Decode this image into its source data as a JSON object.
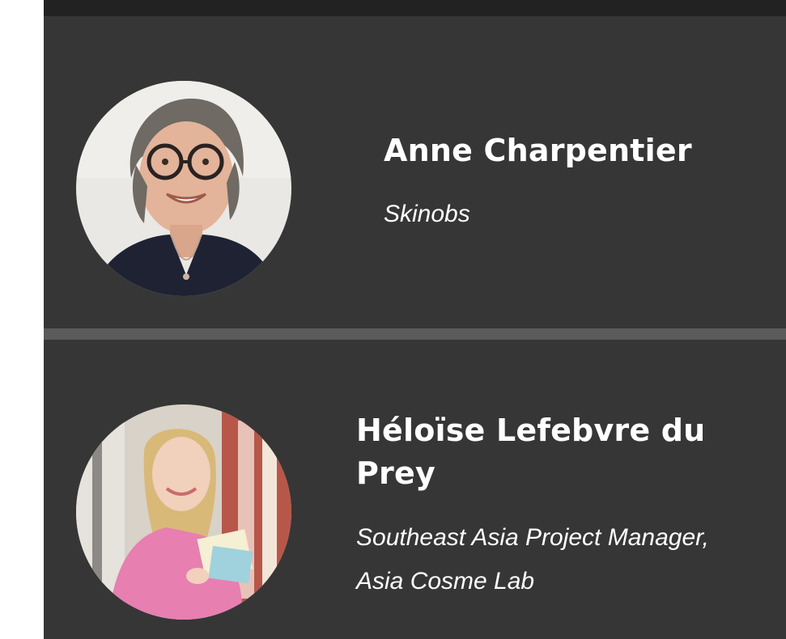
{
  "profiles": [
    {
      "name": "Anne Charpentier",
      "role": "Skinobs",
      "avatar_icon": "profile-photo"
    },
    {
      "name": "Héloïse Lefebvre du Prey",
      "role": "Southeast Asia Project Manager, Asia Cosme Lab",
      "avatar_icon": "profile-photo"
    }
  ],
  "colors": {
    "card_background": "#363636",
    "divider": "#5b5b5b",
    "top_strip": "#222222",
    "text": "#ffffff"
  }
}
